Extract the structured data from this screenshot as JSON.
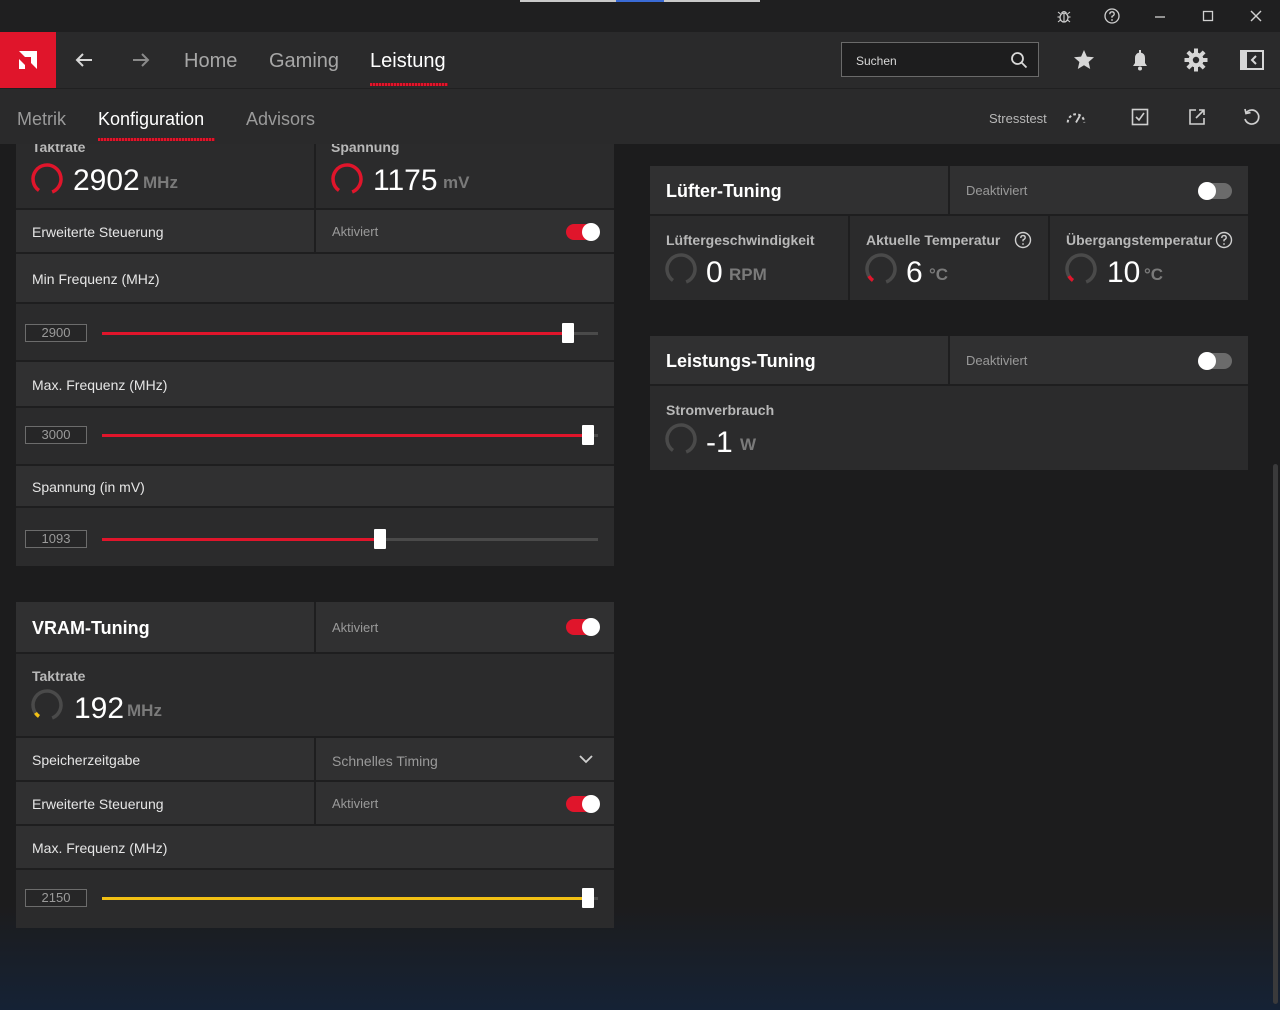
{
  "header": {
    "nav": {
      "home": "Home",
      "gaming": "Gaming",
      "leistung": "Leistung"
    },
    "search_placeholder": "Suchen"
  },
  "subnav": {
    "metrik": "Metrik",
    "konfiguration": "Konfiguration",
    "advisors": "Advisors",
    "stresstest": "Stresstest"
  },
  "gpu": {
    "clock_label": "Taktrate",
    "clock_value": "2902",
    "clock_unit": "MHz",
    "voltage_label": "Spannung",
    "voltage_value": "1175",
    "voltage_unit": "mV",
    "advanced_control_label": "Erweiterte Steuerung",
    "advanced_control_state": "Aktiviert",
    "min_freq_label": "Min Frequenz (MHz)",
    "min_freq_value": "2900",
    "min_freq_fraction": 0.94,
    "max_freq_label": "Max. Frequenz (MHz)",
    "max_freq_value": "3000",
    "max_freq_fraction": 0.98,
    "voltage_slider_label": "Spannung (in mV)",
    "voltage_slider_value": "1093",
    "voltage_slider_fraction": 0.56
  },
  "vram": {
    "title": "VRAM-Tuning",
    "state": "Aktiviert",
    "clock_label": "Taktrate",
    "clock_value": "192",
    "clock_unit": "MHz",
    "timing_label": "Speicherzeitgabe",
    "timing_value": "Schnelles Timing",
    "advanced_control_label": "Erweiterte Steuerung",
    "advanced_control_state": "Aktiviert",
    "max_freq_label": "Max. Frequenz (MHz)",
    "max_freq_value": "2150",
    "max_freq_fraction": 0.98
  },
  "fan": {
    "title": "Lüfter-Tuning",
    "state": "Deaktiviert",
    "speed_label": "Lüftergeschwindigkeit",
    "speed_value": "0",
    "speed_unit": "RPM",
    "temp_label": "Aktuelle Temperatur",
    "temp_value": "6",
    "temp_unit": "°C",
    "junction_label": "Übergangstemperatur",
    "junction_value": "10",
    "junction_unit": "°C"
  },
  "power": {
    "title": "Leistungs-Tuning",
    "state": "Deaktiviert",
    "consumption_label": "Stromverbrauch",
    "consumption_value": "-1",
    "consumption_unit": "W"
  },
  "colors": {
    "accent": "#e0152b",
    "vram_accent": "#f2c014"
  },
  "icons": {
    "titlebar": [
      "bug-icon",
      "help-icon",
      "minimize-icon",
      "maximize-icon",
      "close-icon"
    ],
    "header": [
      "star-icon",
      "bell-icon",
      "gear-icon",
      "sidebar-toggle-icon"
    ],
    "subheader": [
      "speedometer-icon",
      "save-profile-icon",
      "export-icon",
      "reset-icon"
    ]
  }
}
